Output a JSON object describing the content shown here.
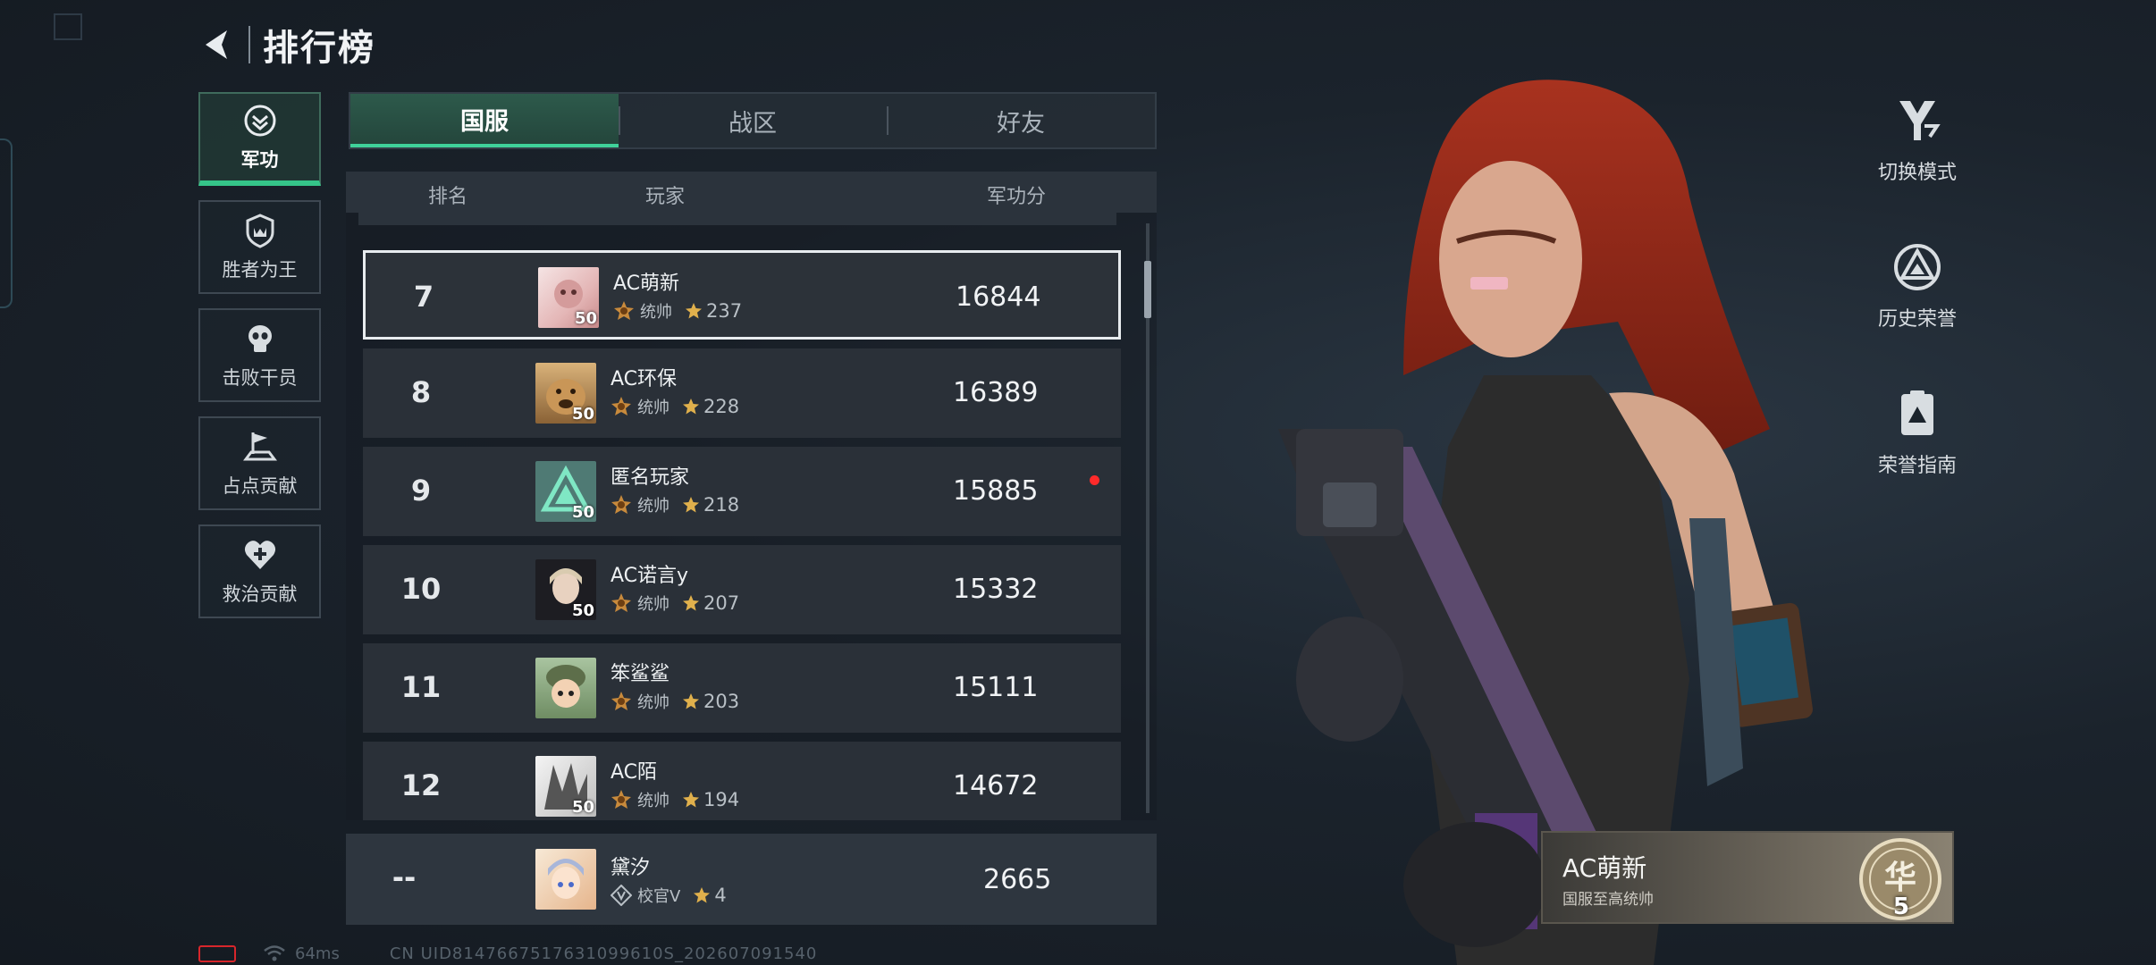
{
  "header": {
    "title": "排行榜"
  },
  "categories": [
    {
      "label": "军功",
      "icon": "chevron-medal-icon",
      "active": true
    },
    {
      "label": "胜者为王",
      "icon": "shield-crown-icon"
    },
    {
      "label": "击败干员",
      "icon": "skull-icon"
    },
    {
      "label": "占点贡献",
      "icon": "flag-point-icon"
    },
    {
      "label": "救治贡献",
      "icon": "heart-plus-icon"
    }
  ],
  "tabs": [
    {
      "label": "国服",
      "active": true
    },
    {
      "label": "战区"
    },
    {
      "label": "好友"
    }
  ],
  "table_header": {
    "rank": "排名",
    "player": "玩家",
    "score": "军功分"
  },
  "rows": [
    {
      "rank": "7",
      "name": "AC萌新",
      "level": "50",
      "title": "统帅",
      "stars": "237",
      "score": "16844",
      "selected": true
    },
    {
      "rank": "8",
      "name": "AC环保",
      "level": "50",
      "title": "统帅",
      "stars": "228",
      "score": "16389"
    },
    {
      "rank": "9",
      "name": "匿名玩家",
      "level": "50",
      "title": "统帅",
      "stars": "218",
      "score": "15885",
      "new_dot": true
    },
    {
      "rank": "10",
      "name": "AC诺言y",
      "level": "50",
      "title": "统帅",
      "stars": "207",
      "score": "15332"
    },
    {
      "rank": "11",
      "name": "笨鲨鲨",
      "level": "",
      "title": "统帅",
      "stars": "203",
      "score": "15111"
    },
    {
      "rank": "12",
      "name": "AC陌",
      "level": "50",
      "title": "统帅",
      "stars": "194",
      "score": "14672"
    }
  ],
  "self_row": {
    "rank": "--",
    "name": "黛汐",
    "title": "校官V",
    "stars": "4",
    "score": "2665"
  },
  "footer": {
    "ping": "64ms",
    "uid": "CN UID8147667517631099610S_202607091540"
  },
  "side_actions": [
    {
      "label": "切换模式",
      "icon": "switch-mode-icon"
    },
    {
      "label": "历史荣誉",
      "icon": "history-honor-icon"
    },
    {
      "label": "荣誉指南",
      "icon": "honor-guide-icon"
    }
  ],
  "player_card": {
    "name": "AC萌新",
    "subtitle": "国服至高统帅",
    "emblem_char": "华",
    "emblem_num": "5"
  },
  "colors": {
    "accent": "#3fd19a",
    "selected_border": "#e8ecef",
    "alert": "#ff2a2a"
  }
}
